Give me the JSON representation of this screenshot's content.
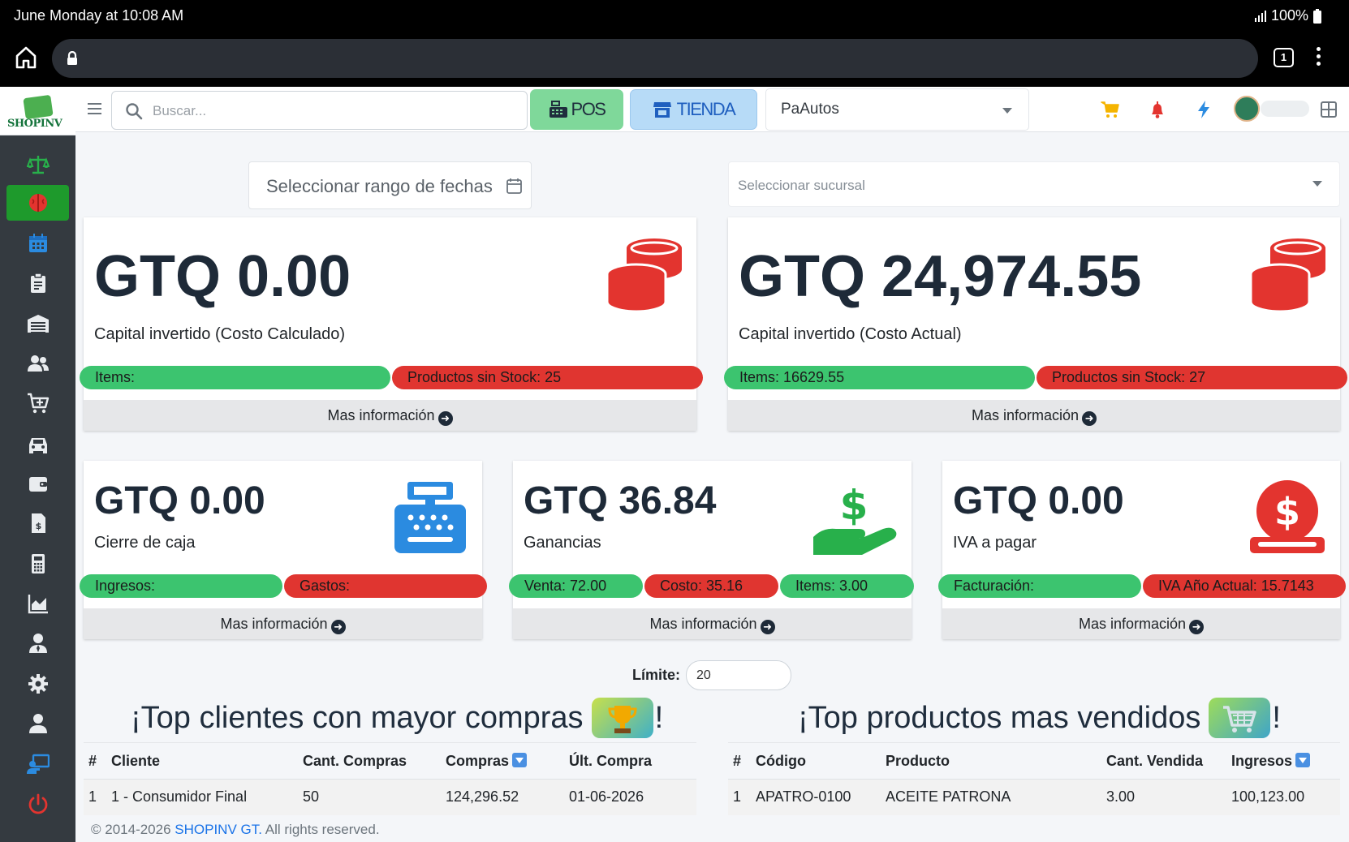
{
  "status_bar": {
    "time": "June Monday at 10:08 AM",
    "battery": "100%"
  },
  "browser": {
    "tab_count": "1"
  },
  "topnav": {
    "search_placeholder": "Buscar...",
    "pos_label": "POS",
    "tienda_label": "TIENDA",
    "empresa": "PaAutos"
  },
  "filters": {
    "date_range_placeholder": "Seleccionar rango de fechas",
    "branch_placeholder": "Seleccionar sucursal"
  },
  "cards": {
    "capital_calc": {
      "amount": "GTQ 0.00",
      "label": "Capital invertido (Costo Calculado)",
      "pill_items": "Items:",
      "pill_stock": "Productos sin Stock: 25",
      "more": "Mas información"
    },
    "capital_actual": {
      "amount": "GTQ 24,974.55",
      "label": "Capital invertido (Costo Actual)",
      "pill_items": "Items: 16629.55",
      "pill_stock": "Productos sin Stock: 27",
      "more": "Mas información"
    },
    "cierre": {
      "amount": "GTQ 0.00",
      "label": "Cierre de caja",
      "pill_ingresos": "Ingresos:",
      "pill_gastos": "Gastos:",
      "more": "Mas información"
    },
    "ganancias": {
      "amount": "GTQ 36.84",
      "label": "Ganancias",
      "pill_venta": "Venta: 72.00",
      "pill_costo": "Costo: 35.16",
      "pill_items": "Items: 3.00",
      "more": "Mas información"
    },
    "iva": {
      "amount": "GTQ 0.00",
      "label": "IVA a pagar",
      "pill_facturacion": "Facturación:",
      "pill_iva_anio": "IVA Año Actual: 15.7143",
      "more": "Mas información"
    }
  },
  "limit": {
    "label": "Límite:",
    "value": "20"
  },
  "top_clientes": {
    "title": "¡Top clientes con mayor compras",
    "headers": [
      "#",
      "Cliente",
      "Cant. Compras",
      "Compras",
      "Últ. Compra"
    ],
    "rows": [
      [
        "1",
        "1 - Consumidor Final",
        "50",
        "124,296.52",
        "01-06-2026"
      ]
    ]
  },
  "top_productos": {
    "title": "¡Top productos mas vendidos",
    "headers": [
      "#",
      "Código",
      "Producto",
      "Cant. Vendida",
      "Ingresos"
    ],
    "rows": [
      [
        "1",
        "APATRO-0100",
        "ACEITE PATRONA",
        "3.00",
        "100,123.00"
      ]
    ]
  },
  "footer": {
    "copyright": "© 2014-2026",
    "brand": "SHOPINV GT.",
    "rights": "All rights reserved."
  },
  "brand": {
    "logo_text": "SHOPINV"
  },
  "colors": {
    "sidebar": "#343a40",
    "active_nav": "#1e9a2c",
    "green_pill": "#3cc46f",
    "red_pill": "#e03530",
    "accent_red": "#e3342f",
    "accent_blue": "#2b8be0",
    "accent_green": "#28b04b"
  },
  "sidebar_icons": [
    "balance-scale-icon",
    "brain-icon",
    "calendar-icon",
    "clipboard-icon",
    "warehouse-icon",
    "users-icon",
    "cart-plus-icon",
    "car-icon",
    "wallet-icon",
    "invoice-icon",
    "calculator-icon",
    "chart-area-icon",
    "user-tie-icon",
    "gear-icon",
    "user-icon",
    "chalkboard-user-icon",
    "power-icon"
  ]
}
